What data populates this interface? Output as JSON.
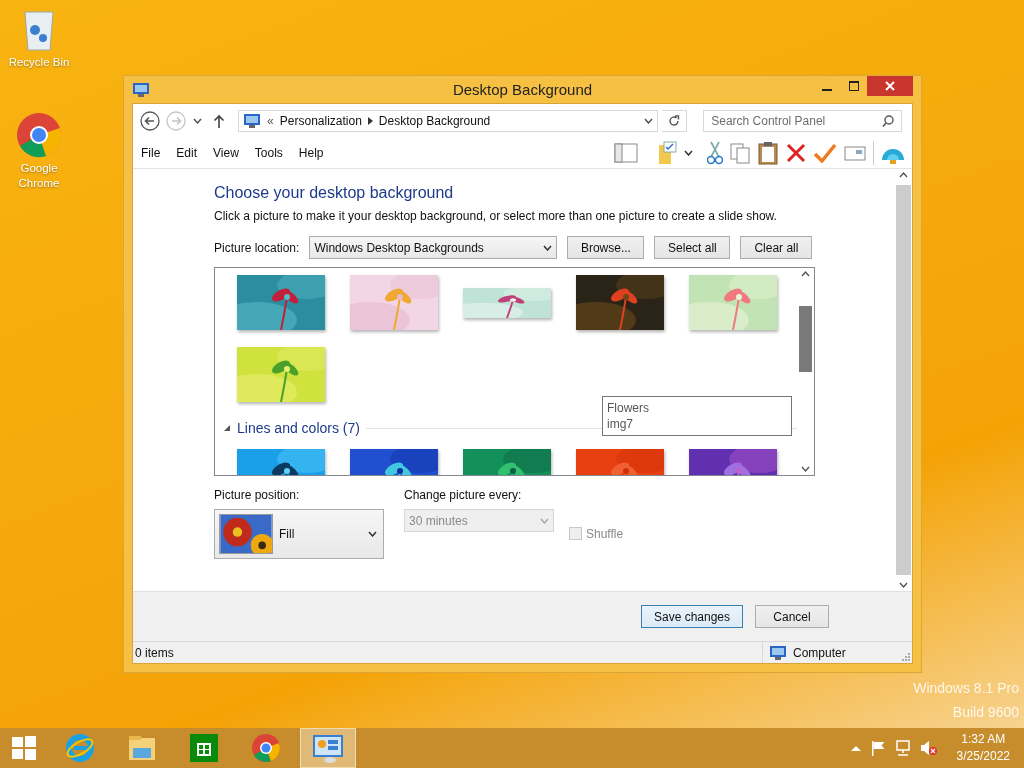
{
  "desktop": {
    "icons": [
      {
        "label": "Recycle Bin",
        "kind": "recycle"
      },
      {
        "label": "Google Chrome",
        "kind": "chrome"
      }
    ],
    "edition": [
      "Windows 8.1 Pro",
      "Build 9600"
    ]
  },
  "window": {
    "title": "Desktop Background",
    "nav": [
      {
        "kind": "back",
        "disabled": false
      },
      {
        "kind": "forward",
        "disabled": true
      }
    ],
    "address": {
      "overflow": "«",
      "crumbs": [
        "Personalization",
        "Desktop Background"
      ]
    },
    "search": {
      "placeholder": "Search Control Panel"
    },
    "menu": [
      "File",
      "Edit",
      "View",
      "Tools",
      "Help"
    ],
    "content": {
      "heading": "Choose your desktop background",
      "description": "Click a picture to make it your desktop background, or select more than one picture to create a slide show.",
      "location": {
        "label": "Picture location:",
        "value": "Windows Desktop Backgrounds"
      },
      "buttons": [
        "Browse...",
        "Select all",
        "Clear all"
      ],
      "gallery": {
        "previous_group_items": [
          {
            "kind": "picture"
          },
          {
            "kind": "picture"
          },
          {
            "kind": "picture"
          },
          {
            "kind": "picture"
          },
          {
            "kind": "picture"
          },
          {
            "kind": "picture"
          }
        ],
        "groups": [
          {
            "title": "Lines and colors (7)",
            "expanded": true,
            "items": [
              {
                "kind": "picture"
              },
              {
                "kind": "picture"
              },
              {
                "kind": "picture"
              },
              {
                "kind": "picture"
              },
              {
                "kind": "picture"
              }
            ]
          }
        ],
        "tooltip": [
          "Flowers",
          "img7"
        ]
      },
      "position": {
        "label": "Picture position:",
        "value": "Fill"
      },
      "interval": {
        "label": "Change picture every:",
        "value": "30 minutes",
        "disabled": true
      },
      "shuffle": {
        "label": "Shuffle",
        "checked": false,
        "disabled": true
      }
    },
    "footer": [
      {
        "label": "Save changes",
        "focused": true
      },
      {
        "label": "Cancel",
        "focused": false
      }
    ],
    "status": {
      "items": "0 items",
      "zone": "Computer"
    }
  },
  "taskbar": {
    "apps": [
      {
        "kind": "ie",
        "selected": false
      },
      {
        "kind": "explorer",
        "selected": false
      },
      {
        "kind": "store",
        "selected": false
      },
      {
        "kind": "chrome",
        "selected": false
      },
      {
        "kind": "control",
        "selected": true
      }
    ],
    "time": "1:32 AM",
    "date": "3/25/2022"
  }
}
